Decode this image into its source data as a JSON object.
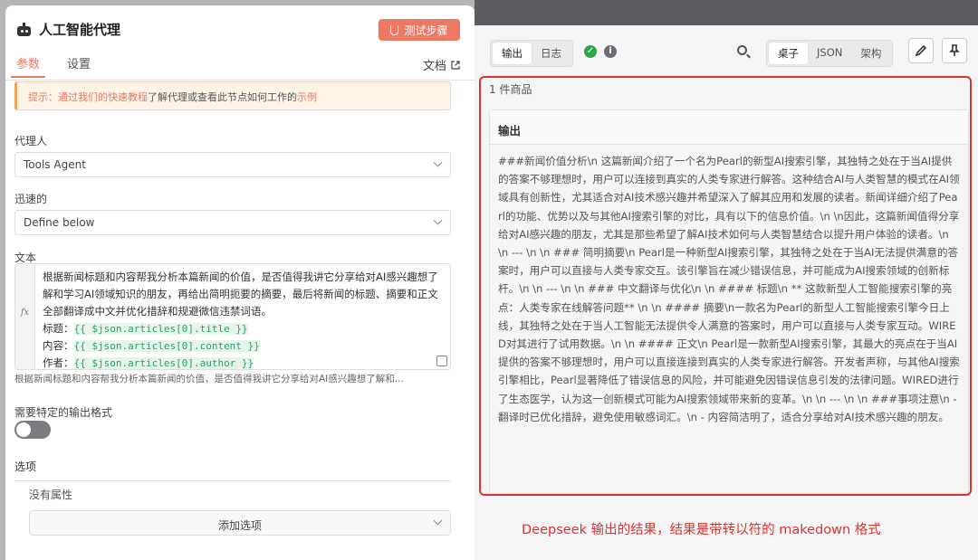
{
  "left_panel": {
    "title": "人工智能代理",
    "test_button": "测试步骤",
    "tabs": [
      "参数",
      "设置"
    ],
    "docs_link": "文档",
    "hint": {
      "prefix": "提示：",
      "link": "通过我们的快速教程",
      "middle": "了解代理或查看此节点如何工作的",
      "example": "示例"
    },
    "agent_label": "代理人",
    "agent_value": "Tools Agent",
    "prompt_label": "迅速的",
    "prompt_value": "Define below",
    "text_label": "文本",
    "fx": "fx",
    "editor": {
      "line1": "根据新闻标题和内容帮我分析本篇新闻的价值，是否值得我讲它分享给对AI感兴趣想了解和学习AI领域知识的朋友，再给出简明扼要的摘要，最后将新闻的标题、摘要和正文全部翻译成中文并优化措辞和规避微信违禁词语。",
      "title_label": "标题：",
      "title_expr": "{{ $json.articles[0].title }}",
      "content_label": "内容：",
      "content_expr": "{{ $json.articles[0].content }}",
      "author_label": "作者：",
      "author_expr": "{{ $json.articles[0].author }}"
    },
    "preview": "根据新闻标题和内容帮我分析本篇新闻的价值，是否值得我讲它分享给对AI感兴趣想了解和...",
    "format_label": "需要特定的输出格式",
    "format_toggle": false,
    "options_label": "选项",
    "no_props": "没有属性",
    "add_option": "添加选项"
  },
  "right_panel": {
    "view_tabs": [
      "输出",
      "日志"
    ],
    "status_ok": "✓",
    "info": "i",
    "format_tabs": [
      "桌子",
      "JSON",
      "架构"
    ],
    "item_count": "1 件商品",
    "card_title": "输出",
    "output_text": "###新闻价值分析\\n 这篇新闻介绍了一个名为Pearl的新型AI搜索引擎，其独特之处在于当AI提供的答案不够理想时，用户可以连接到真实的人类专家进行解答。这种结合AI与人类智慧的模式在AI领域具有创新性，尤其适合对AI技术感兴趣并希望深入了解其应用和发展的读者。新闻详细介绍了Pearl的功能、优势以及与其他AI搜索引擎的对比，具有以下的信息价值。\\n \\n因此，这篇新闻值得分享给对AI感兴趣的朋友，尤其是那些希望了解AI技术如何与人类智慧结合以提升用户体验的读者。\\n \\n --- \\n \\n ### 简明摘要\\n Pearl是一种新型AI搜索引擎，其独特之处在于当AI无法提供满意的答案时，用户可以直接与人类专家交互。该引擎旨在减少错误信息，并可能成为AI搜索领域的创新标杆。\\n \\n --- \\n \\n ### 中文翻译与优化\\n \\n #### 标题\\n ** 这款新型人工智能搜索引擎的亮点：人类专家在线解答问题** \\n \\n #### 摘要\\n一款名为Pearl的新型人工智能搜索引擎今日上线，其独特之处在于当人工智能无法提供令人满意的答案时，用户可以直接与人类专家互动。WIRED对其进行了试用数据。\\n \\n #### 正文\\n Pearl是一款新型AI搜索引擎，其最大的亮点在于当AI提供的答案不够理想时，用户可以直接连接到真实的人类专家进行解答。开发者声称，与其他AI搜索引擎相比，Pearl显著降低了错误信息的风险，并可能避免因错误信息引发的法律问题。WIRED进行了生态医学，认为这一创新模式可能为AI搜索领域带来新的变革。\\n \\n --- \\n \\n ###事项注意\\n -翻译时已优化措辞，避免使用敏感词汇。\\n - 内容简洁明了，适合分享给对AI技术感兴趣的朋友。",
    "caption": "Deepseek 输出的结果，结果是带转以符的 makedown 格式"
  },
  "colors": {
    "accent": "#ea7a64",
    "annotation_red": "#e0322a",
    "success": "#2fa44f",
    "code_green": "#2c9f6c"
  },
  "icons": {
    "title_icon": "robot-icon",
    "test_icon": "flask-icon",
    "docs_icon": "external-link-icon",
    "status_icon": "check-circle-icon",
    "info_icon": "info-icon",
    "search_icon": "search-icon",
    "edit_icon": "pencil-icon",
    "pin_icon": "pin-icon"
  }
}
